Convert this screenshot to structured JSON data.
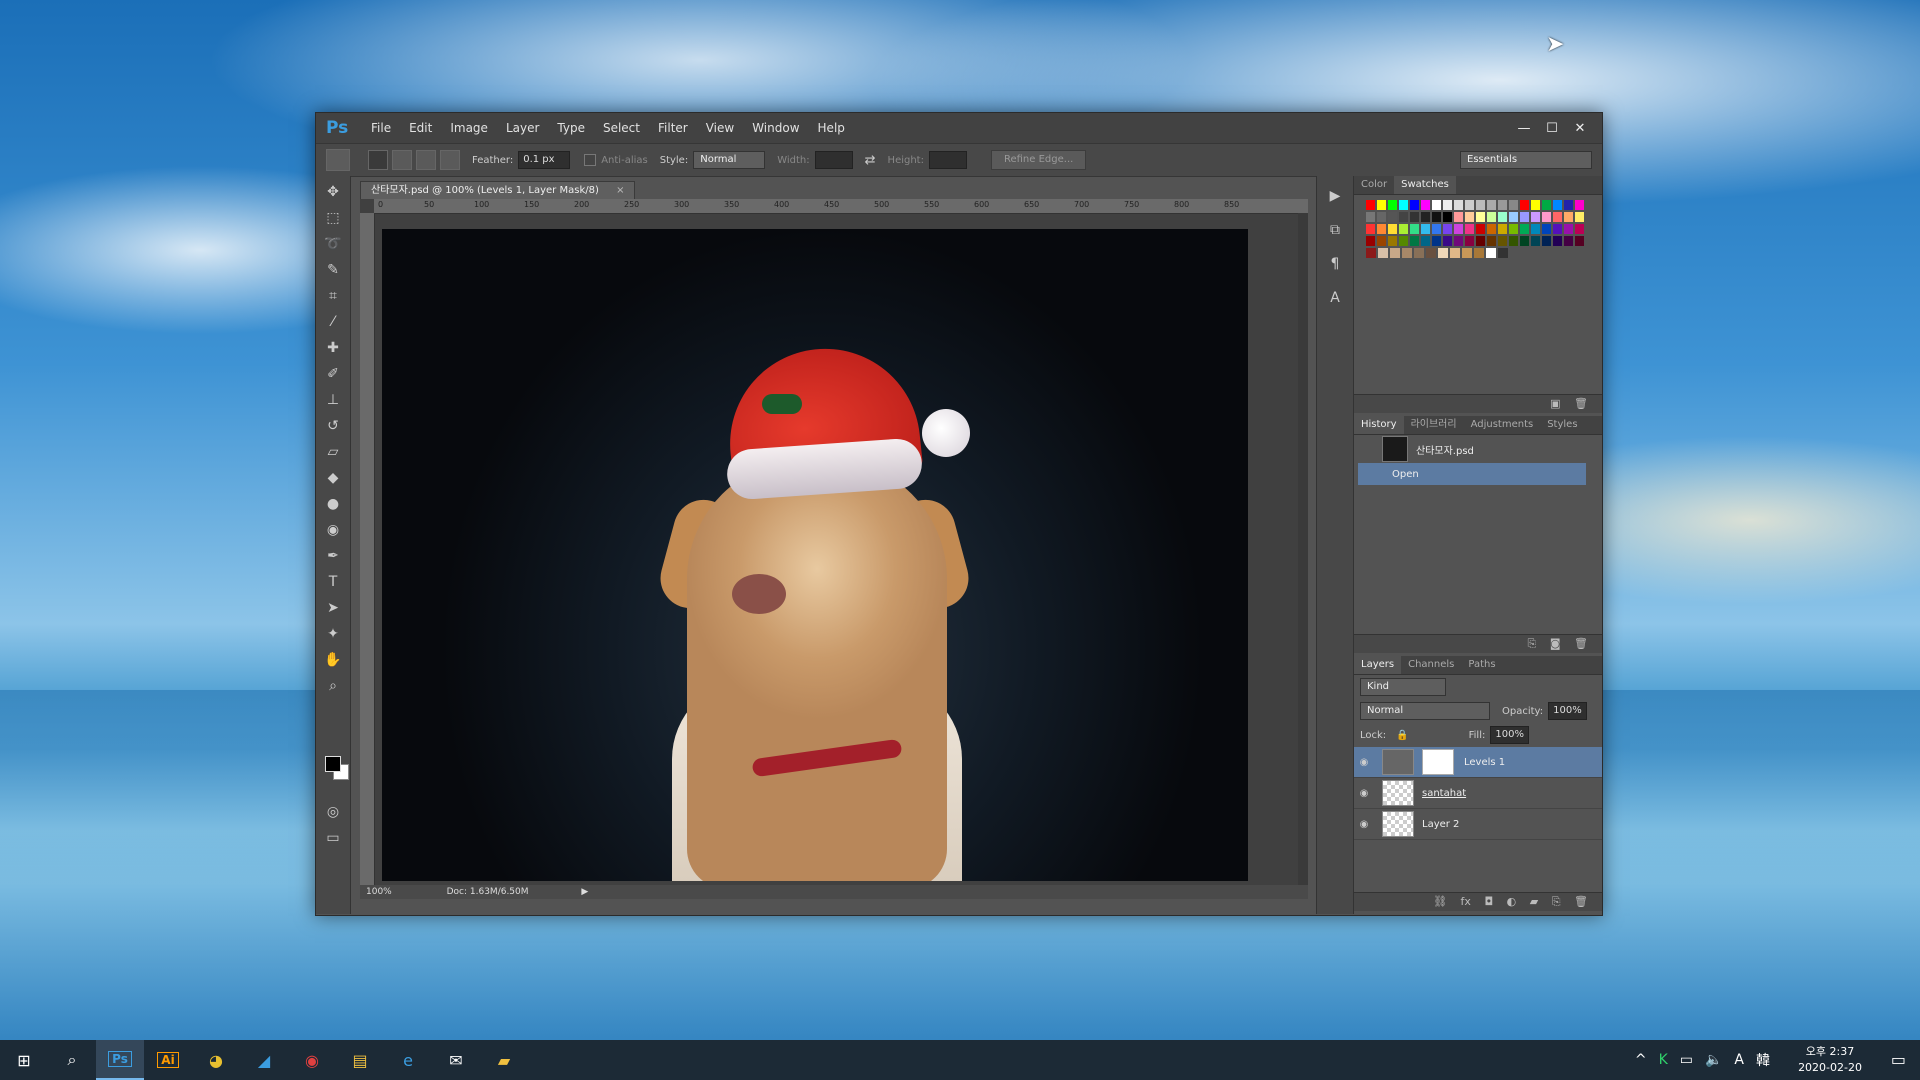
{
  "app": {
    "logo": "Ps",
    "menu": [
      "File",
      "Edit",
      "Image",
      "Layer",
      "Type",
      "Select",
      "Filter",
      "View",
      "Window",
      "Help"
    ],
    "window_controls": {
      "minimize": "—",
      "maximize": "☐",
      "close": "✕"
    }
  },
  "options": {
    "feather_label": "Feather:",
    "feather_value": "0.1 px",
    "antialias_label": "Anti-alias",
    "style_label": "Style:",
    "style_value": "Normal",
    "width_label": "Width:",
    "height_label": "Height:",
    "refine_edge": "Refine Edge...",
    "workspace": "Essentials"
  },
  "document": {
    "tab_title": "산타모자.psd @ 100% (Levels 1, Layer Mask/8)",
    "tab_close": "×",
    "ruler_ticks": [
      "0",
      "50",
      "100",
      "150",
      "200",
      "250",
      "300",
      "350",
      "400",
      "450",
      "500",
      "550",
      "600",
      "650",
      "700",
      "750",
      "800",
      "850"
    ],
    "zoom": "100%",
    "doc_info": "Doc: 1.63M/6.50M"
  },
  "swatches_panel": {
    "tabs": [
      "Color",
      "Swatches"
    ],
    "active_tab": "Swatches",
    "rows": [
      [
        "#ff0000",
        "#ffff00",
        "#00ff00",
        "#00ffff",
        "#0000ff",
        "#ff00ff",
        "#ffffff",
        "#eeeeee",
        "#dddddd",
        "#cccccc",
        "#bbbbbb",
        "#aaaaaa",
        "#999999",
        "#888888",
        "#ff0000",
        "#ffff00",
        "#00aa44",
        "#0088ff",
        "#2222aa",
        "#ff00cc"
      ],
      [
        "#777777",
        "#666666",
        "#555555",
        "#444444",
        "#333333",
        "#222222",
        "#111111",
        "#000000",
        "#ff9999",
        "#ffcc99",
        "#ffff99",
        "#ccff99",
        "#99ffcc",
        "#99ccff",
        "#9999ff",
        "#cc99ff",
        "#ff99cc",
        "#ff6666",
        "#ffaa66",
        "#ffee66"
      ],
      [
        "#ff3333",
        "#ff8833",
        "#ffdd33",
        "#aaee33",
        "#33dd88",
        "#33bbee",
        "#3377ee",
        "#7744ee",
        "#cc44dd",
        "#ee3388",
        "#cc0000",
        "#cc6600",
        "#ccaa00",
        "#77bb00",
        "#00aa55",
        "#0088bb",
        "#0044bb",
        "#5511bb",
        "#9911aa",
        "#bb0055"
      ],
      [
        "#990000",
        "#994400",
        "#997700",
        "#558800",
        "#007744",
        "#006688",
        "#003388",
        "#3a0a88",
        "#700a7a",
        "#880040",
        "#660000",
        "#663300",
        "#665500",
        "#335500",
        "#004422",
        "#004455",
        "#002255",
        "#220055",
        "#440044",
        "#550022"
      ],
      [
        "#8b1a1a",
        "#d8c0a8",
        "#c8a888",
        "#a88868",
        "#887058",
        "#685040",
        "#f0d8b8",
        "#e0b888",
        "#c89858",
        "#a87838",
        "#ffffff",
        "#333333"
      ]
    ]
  },
  "history_panel": {
    "tabs": [
      "History",
      "라이브러리",
      "Adjustments",
      "Styles"
    ],
    "snapshot_name": "산타모자.psd",
    "steps": [
      "Open"
    ]
  },
  "layers_panel": {
    "tabs": [
      "Layers",
      "Channels",
      "Paths"
    ],
    "filter_kind": "Kind",
    "blend_mode": "Normal",
    "opacity_label": "Opacity:",
    "opacity_value": "100%",
    "lock_label": "Lock:",
    "fill_label": "Fill:",
    "fill_value": "100%",
    "layers": [
      {
        "name": "Levels 1",
        "selected": true
      },
      {
        "name": "santahat",
        "selected": false
      },
      {
        "name": "Layer 2",
        "selected": false
      }
    ]
  },
  "taskbar": {
    "clock_time": "오후 2:37",
    "clock_date": "2020-02-20",
    "ime": "A",
    "ime2": "韓",
    "apps": [
      "Ps",
      "Ai"
    ]
  }
}
